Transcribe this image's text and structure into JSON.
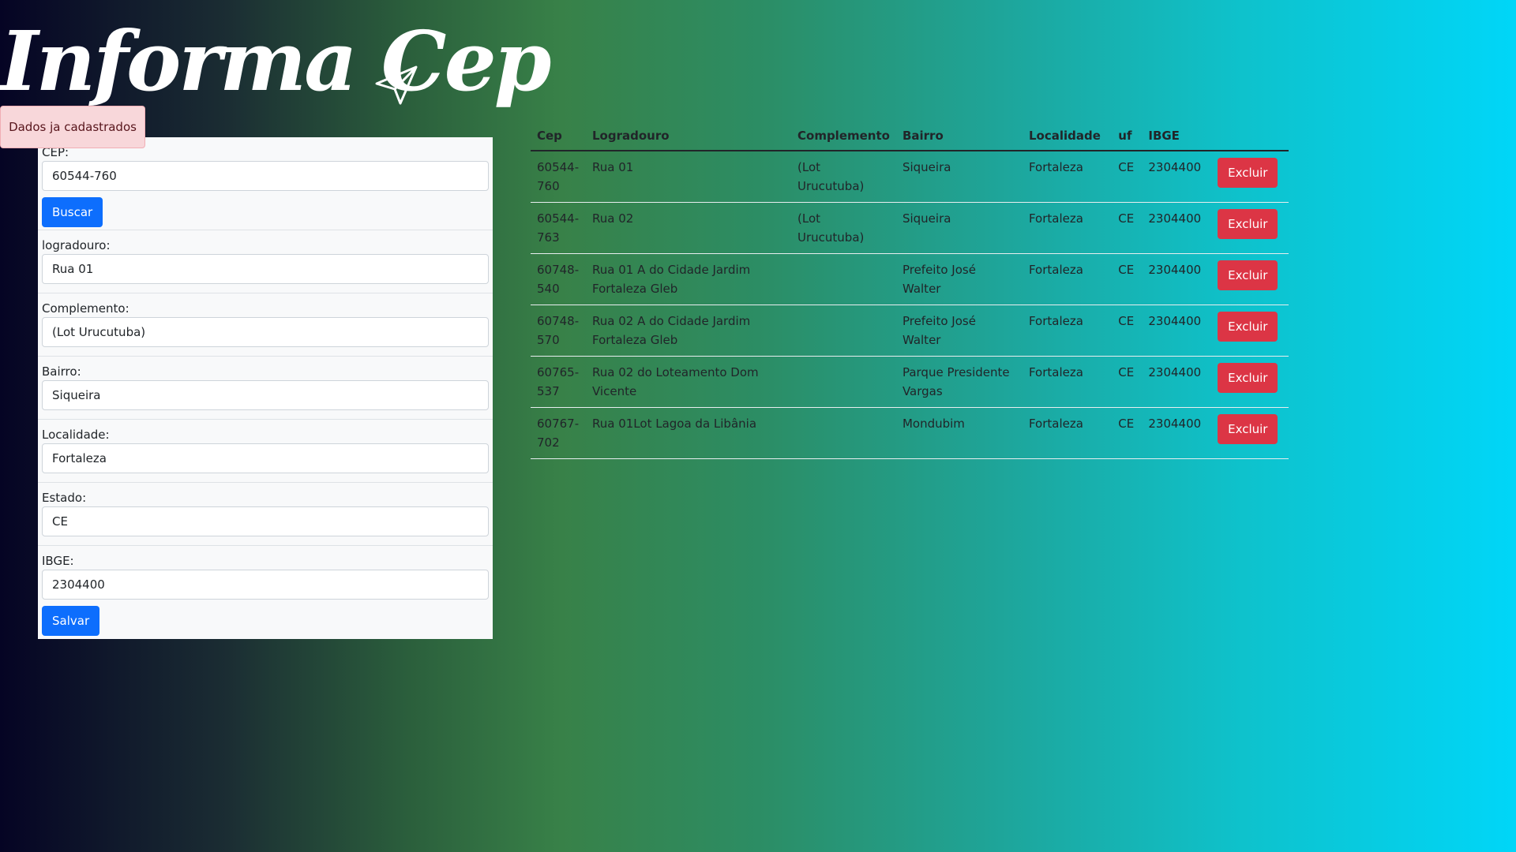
{
  "header": {
    "title": "Informa Cep"
  },
  "alert": {
    "message": "Dados ja cadastrados"
  },
  "form": {
    "cep_label": "CEP:",
    "cep_value": "60544-760",
    "search_label": "Buscar",
    "logradouro_label": "logradouro:",
    "logradouro_value": "Rua 01",
    "complemento_label": "Complemento:",
    "complemento_value": "(Lot Urucutuba)",
    "bairro_label": "Bairro:",
    "bairro_value": "Siqueira",
    "localidade_label": "Localidade:",
    "localidade_value": "Fortaleza",
    "estado_label": "Estado:",
    "estado_value": "CE",
    "ibge_label": "IBGE:",
    "ibge_value": "2304400",
    "save_label": "Salvar"
  },
  "table": {
    "headers": [
      "Cep",
      "Logradouro",
      "Complemento",
      "Bairro",
      "Localidade",
      "uf",
      "IBGE"
    ],
    "delete_label": "Excluir",
    "rows": [
      {
        "cep": "60544-760",
        "logradouro": "Rua 01",
        "complemento": "(Lot Urucutuba)",
        "bairro": "Siqueira",
        "localidade": "Fortaleza",
        "uf": "CE",
        "ibge": "2304400"
      },
      {
        "cep": "60544-763",
        "logradouro": "Rua 02",
        "complemento": "(Lot Urucutuba)",
        "bairro": "Siqueira",
        "localidade": "Fortaleza",
        "uf": "CE",
        "ibge": "2304400"
      },
      {
        "cep": "60748-540",
        "logradouro": "Rua 01 A do Cidade Jardim Fortaleza Gleb",
        "complemento": "",
        "bairro": "Prefeito José Walter",
        "localidade": "Fortaleza",
        "uf": "CE",
        "ibge": "2304400"
      },
      {
        "cep": "60748-570",
        "logradouro": "Rua 02 A do Cidade Jardim Fortaleza Gleb",
        "complemento": "",
        "bairro": "Prefeito José Walter",
        "localidade": "Fortaleza",
        "uf": "CE",
        "ibge": "2304400"
      },
      {
        "cep": "60765-537",
        "logradouro": "Rua 02 do Loteamento Dom Vicente",
        "complemento": "",
        "bairro": "Parque Presidente Vargas",
        "localidade": "Fortaleza",
        "uf": "CE",
        "ibge": "2304400"
      },
      {
        "cep": "60767-702",
        "logradouro": "Rua 01Lot Lagoa da Libânia",
        "complemento": "",
        "bairro": "Mondubim",
        "localidade": "Fortaleza",
        "uf": "CE",
        "ibge": "2304400"
      }
    ]
  },
  "icons": {
    "header_icon": "paper-plane-icon"
  },
  "colors": {
    "primary": "#0d6efd",
    "danger": "#dc3545",
    "alert_bg": "#f8d7da"
  }
}
